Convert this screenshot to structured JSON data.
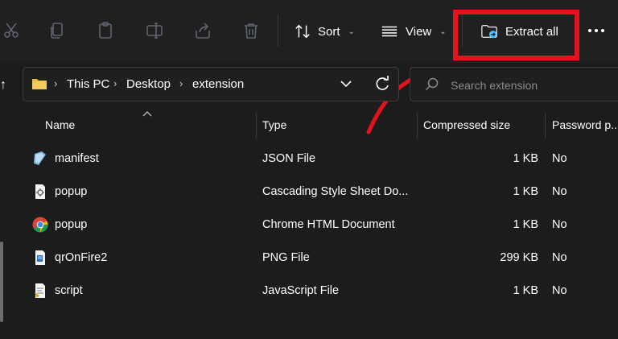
{
  "toolbar": {
    "icons": [
      "cut-icon",
      "copy-icon",
      "paste-icon",
      "rename-icon",
      "share-icon",
      "delete-icon"
    ],
    "sort_label": "Sort",
    "view_label": "View",
    "extract_label": "Extract all",
    "more_icon": "more-options-icon"
  },
  "annotation": {
    "highlight_color": "#e3141b"
  },
  "address_bar": {
    "crumbs": [
      "This PC",
      "Desktop",
      "extension"
    ]
  },
  "search": {
    "placeholder": "Search extension"
  },
  "columns": {
    "name": "Name",
    "type": "Type",
    "compressed_size": "Compressed size",
    "password": "Password p..."
  },
  "files": [
    {
      "name": "manifest",
      "type": "JSON File",
      "size": "1 KB",
      "password": "No",
      "icon": "json-file-icon"
    },
    {
      "name": "popup",
      "type": "Cascading Style Sheet Do...",
      "size": "1 KB",
      "password": "No",
      "icon": "css-file-icon"
    },
    {
      "name": "popup",
      "type": "Chrome HTML Document",
      "size": "1 KB",
      "password": "No",
      "icon": "chrome-icon"
    },
    {
      "name": "qrOnFire2",
      "type": "PNG File",
      "size": "299 KB",
      "password": "No",
      "icon": "png-file-icon"
    },
    {
      "name": "script",
      "type": "JavaScript File",
      "size": "1 KB",
      "password": "No",
      "icon": "js-file-icon"
    }
  ],
  "colors": {
    "background": "#1c1c1c",
    "toolbar": "#202020",
    "accent_blue": "#4cc2ff",
    "folder_yellow": "#e8b93d"
  }
}
